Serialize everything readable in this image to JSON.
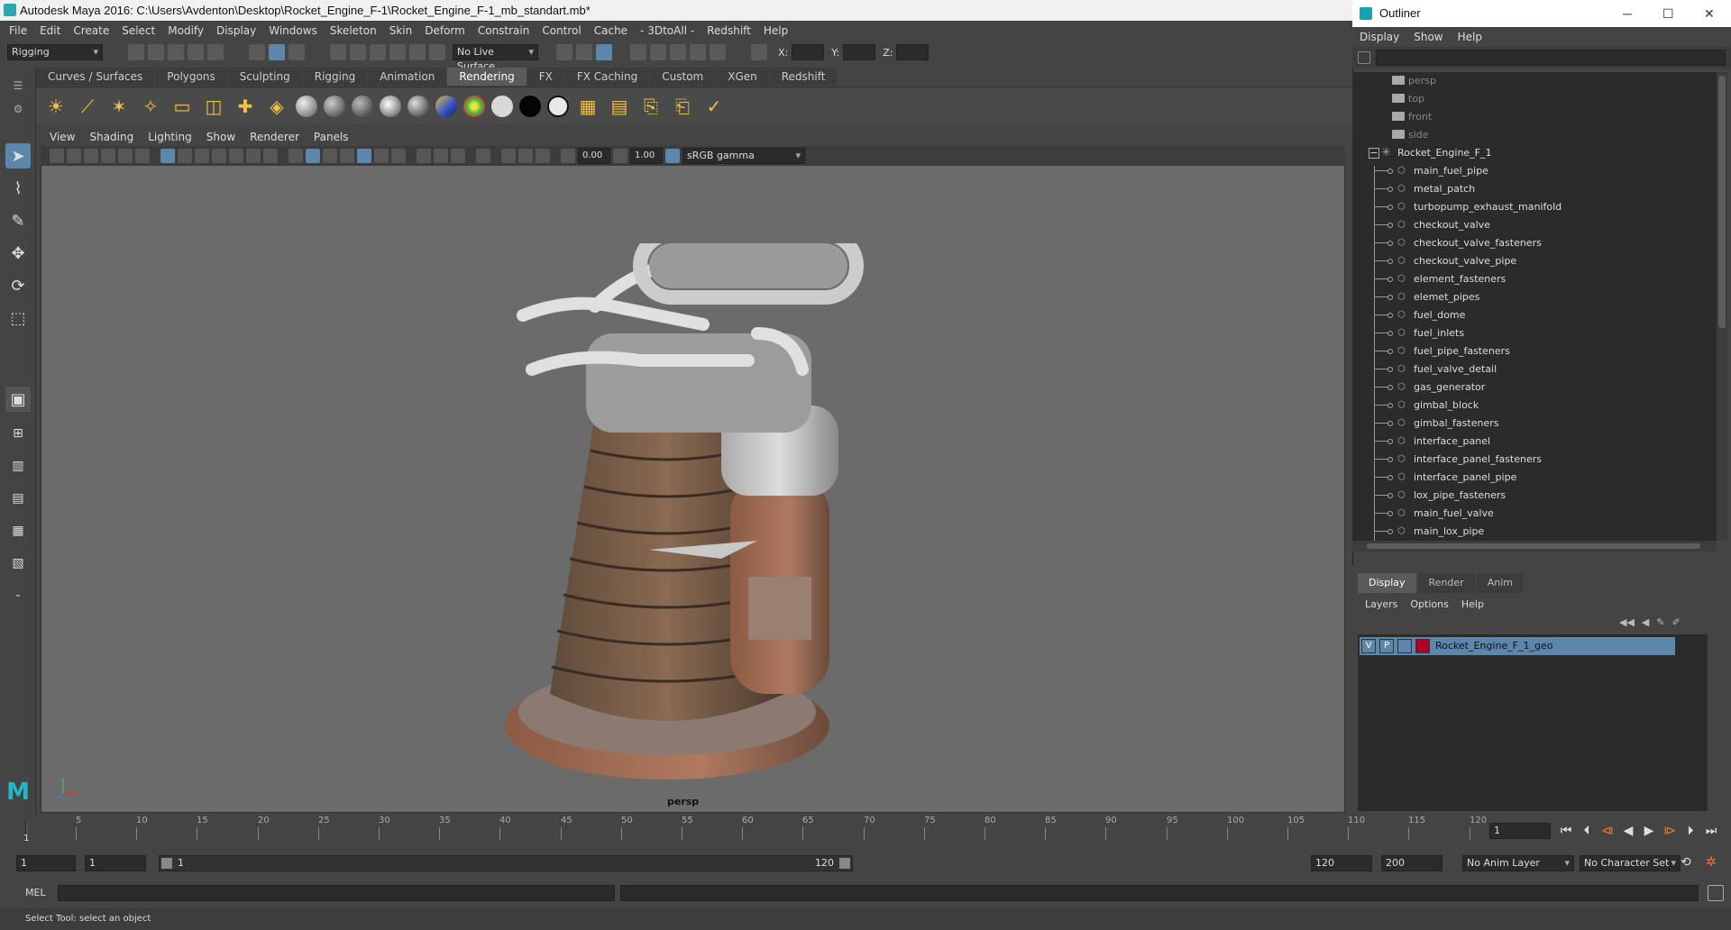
{
  "window": {
    "title": "Autodesk Maya 2016: C:\\Users\\Avdenton\\Desktop\\Rocket_Engine_F-1\\Rocket_Engine_F-1_mb_standart.mb*"
  },
  "menubar": [
    "File",
    "Edit",
    "Create",
    "Select",
    "Modify",
    "Display",
    "Windows",
    "Skeleton",
    "Skin",
    "Deform",
    "Constrain",
    "Control",
    "Cache",
    "- 3DtoAll -",
    "Redshift",
    "Help"
  ],
  "statusline": {
    "menuset": "Rigging",
    "live_surface": "No Live Surface",
    "x_label": "X:",
    "y_label": "Y:",
    "z_label": "Z:"
  },
  "shelf": {
    "tabs": [
      "Curves / Surfaces",
      "Polygons",
      "Sculpting",
      "Rigging",
      "Animation",
      "Rendering",
      "FX",
      "FX Caching",
      "Custom",
      "XGen",
      "Redshift"
    ],
    "active_tab": "Rendering"
  },
  "viewport": {
    "menu": [
      "View",
      "Shading",
      "Lighting",
      "Show",
      "Renderer",
      "Panels"
    ],
    "exposure": "0.00",
    "gamma": "1.00",
    "color_space": "sRGB gamma",
    "camera_label": "persp"
  },
  "outliner": {
    "title": "Outliner",
    "menu": [
      "Display",
      "Show",
      "Help"
    ],
    "cameras": [
      "persp",
      "top",
      "front",
      "side"
    ],
    "group": "Rocket_Engine_F_1",
    "items": [
      "main_fuel_pipe",
      "metal_patch",
      "turbopump_exhaust_manifold",
      "checkout_valve",
      "checkout_valve_fasteners",
      "checkout_valve_pipe",
      "element_fasteners",
      "elemet_pipes",
      "fuel_dome",
      "fuel_inlets",
      "fuel_pipe_fasteners",
      "fuel_valve_detail",
      "gas_generator",
      "gimbal_block",
      "gimbal_fasteners",
      "interface_panel",
      "interface_panel_fasteners",
      "interface_panel_pipe",
      "lox_pipe_fasteners",
      "main_fuel_valve",
      "main_lox_pipe"
    ]
  },
  "layers": {
    "tabs": [
      "Display",
      "Render",
      "Anim"
    ],
    "active_tab": "Display",
    "menu": [
      "Layers",
      "Options",
      "Help"
    ],
    "layer": {
      "v": "V",
      "p": "P",
      "name": "Rocket_Engine_F_1_geo",
      "color": "#b0002a"
    }
  },
  "timeline": {
    "ticks": [
      "5",
      "10",
      "15",
      "20",
      "25",
      "30",
      "35",
      "40",
      "45",
      "50",
      "55",
      "60",
      "65",
      "70",
      "75",
      "80",
      "85",
      "90",
      "95",
      "100",
      "105",
      "110",
      "115",
      "120"
    ],
    "start_tick": "1",
    "current_frame": "1"
  },
  "range": {
    "start": "1",
    "start_inner": "1",
    "slider_start": "1",
    "slider_end": "120",
    "end_inner": "120",
    "end": "200",
    "anim_layer": "No Anim Layer",
    "character_set": "No Character Set"
  },
  "cmdline": {
    "label": "MEL"
  },
  "help": {
    "text": "Select Tool: select an object"
  }
}
